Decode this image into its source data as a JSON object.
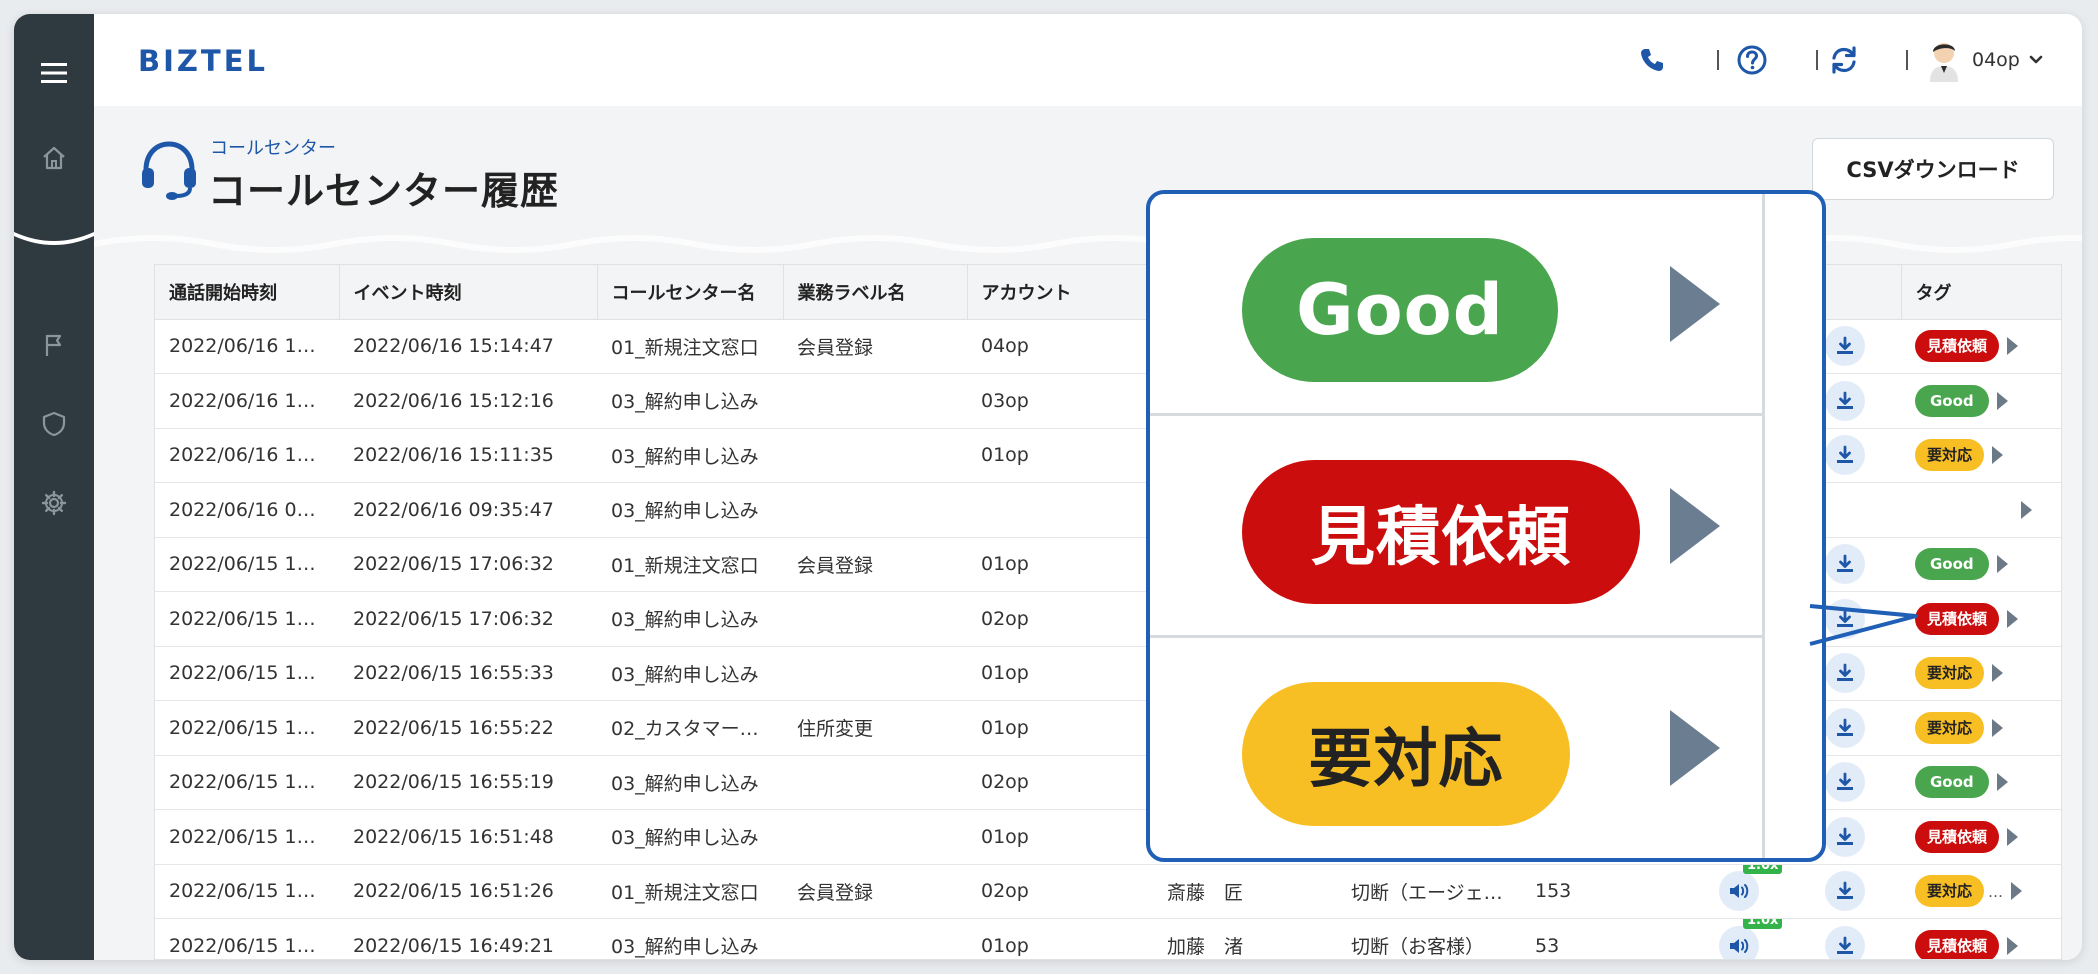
{
  "app": {
    "logo": "BIZTEL"
  },
  "user": {
    "name": "04op"
  },
  "page": {
    "breadcrumb": "コールセンター",
    "title": "コールセンター履歴",
    "csv_button": "CSVダウンロード"
  },
  "table": {
    "headers": [
      "通話開始時刻",
      "イベント時刻",
      "コールセンター名",
      "業務ラベル名",
      "アカウント",
      "",
      "",
      "",
      "",
      "",
      "タグ"
    ],
    "rows": [
      {
        "start": "2022/06/16 1…",
        "event": "2022/06/16 15:14:47",
        "center": "01_新規注文窓口",
        "label": "会員登録",
        "account": "04op",
        "agent": "",
        "result": "",
        "duration": "",
        "speaker": false,
        "speed": "",
        "download": true,
        "tag": "見積依頼",
        "tag_type": "quote",
        "more": ""
      },
      {
        "start": "2022/06/16 1…",
        "event": "2022/06/16 15:12:16",
        "center": "03_解約申し込み",
        "label": "",
        "account": "03op",
        "agent": "",
        "result": "",
        "duration": "",
        "speaker": false,
        "speed": "",
        "download": true,
        "tag": "Good",
        "tag_type": "good",
        "more": ""
      },
      {
        "start": "2022/06/16 1…",
        "event": "2022/06/16 15:11:35",
        "center": "03_解約申し込み",
        "label": "",
        "account": "01op",
        "agent": "",
        "result": "",
        "duration": "",
        "speaker": false,
        "speed": "",
        "download": true,
        "tag": "要対応",
        "tag_type": "action",
        "more": ""
      },
      {
        "start": "2022/06/16 0…",
        "event": "2022/06/16 09:35:47",
        "center": "03_解約申し込み",
        "label": "",
        "account": "",
        "agent": "",
        "result": "",
        "duration": "",
        "speaker": false,
        "speed": "",
        "download": false,
        "tag": "",
        "tag_type": "",
        "more": ""
      },
      {
        "start": "2022/06/15 1…",
        "event": "2022/06/15 17:06:32",
        "center": "01_新規注文窓口",
        "label": "会員登録",
        "account": "01op",
        "agent": "",
        "result": "",
        "duration": "",
        "speaker": false,
        "speed": "",
        "download": true,
        "tag": "Good",
        "tag_type": "good",
        "more": ""
      },
      {
        "start": "2022/06/15 1…",
        "event": "2022/06/15 17:06:32",
        "center": "03_解約申し込み",
        "label": "",
        "account": "02op",
        "agent": "",
        "result": "",
        "duration": "",
        "speaker": false,
        "speed": "",
        "download": true,
        "tag": "見積依頼",
        "tag_type": "quote",
        "more": ""
      },
      {
        "start": "2022/06/15 1…",
        "event": "2022/06/15 16:55:33",
        "center": "03_解約申し込み",
        "label": "",
        "account": "01op",
        "agent": "",
        "result": "",
        "duration": "",
        "speaker": false,
        "speed": "",
        "download": true,
        "tag": "要対応",
        "tag_type": "action",
        "more": ""
      },
      {
        "start": "2022/06/15 1…",
        "event": "2022/06/15 16:55:22",
        "center": "02_カスタマー…",
        "label": "住所変更",
        "account": "01op",
        "agent": "",
        "result": "",
        "duration": "",
        "speaker": false,
        "speed": "",
        "download": true,
        "tag": "要対応",
        "tag_type": "action",
        "more": ""
      },
      {
        "start": "2022/06/15 1…",
        "event": "2022/06/15 16:55:19",
        "center": "03_解約申し込み",
        "label": "",
        "account": "02op",
        "agent": "",
        "result": "",
        "duration": "",
        "speaker": false,
        "speed": "",
        "download": true,
        "tag": "Good",
        "tag_type": "good",
        "more": ""
      },
      {
        "start": "2022/06/15 1…",
        "event": "2022/06/15 16:51:48",
        "center": "03_解約申し込み",
        "label": "",
        "account": "01op",
        "agent": "",
        "result": "",
        "duration": "",
        "speaker": false,
        "speed": "",
        "download": true,
        "tag": "見積依頼",
        "tag_type": "quote",
        "more": ""
      },
      {
        "start": "2022/06/15 1…",
        "event": "2022/06/15 16:51:26",
        "center": "01_新規注文窓口",
        "label": "会員登録",
        "account": "02op",
        "agent": "斎藤　匠",
        "result": "切断（エージェ…",
        "duration": "153",
        "speaker": true,
        "speed": "1.0x",
        "download": true,
        "tag": "要対応",
        "tag_type": "action",
        "more": "…"
      },
      {
        "start": "2022/06/15 1…",
        "event": "2022/06/15 16:49:21",
        "center": "03_解約申し込み",
        "label": "",
        "account": "01op",
        "agent": "加藤　渚",
        "result": "切断（お客様）",
        "duration": "53",
        "speaker": true,
        "speed": "1.0x",
        "download": true,
        "tag": "見積依頼",
        "tag_type": "quote",
        "more": ""
      }
    ]
  },
  "callout": {
    "items": [
      {
        "label": "Good",
        "type": "good"
      },
      {
        "label": "見積依頼",
        "type": "quote"
      },
      {
        "label": "要対応",
        "type": "action"
      }
    ]
  },
  "colors": {
    "brand": "#1e57a8",
    "sidebar": "#2f3a40",
    "good": "#4aa64e",
    "quote": "#cc0d0d",
    "action": "#f8bf25",
    "callout_border": "#1f5fb5"
  },
  "icons": [
    "menu-icon",
    "home-icon",
    "flag-icon",
    "shield-icon",
    "gear-icon",
    "phone-icon",
    "help-icon",
    "refresh-icon",
    "chevron-down-icon",
    "headset-icon",
    "download-icon",
    "speaker-icon",
    "play-arrow-icon"
  ]
}
